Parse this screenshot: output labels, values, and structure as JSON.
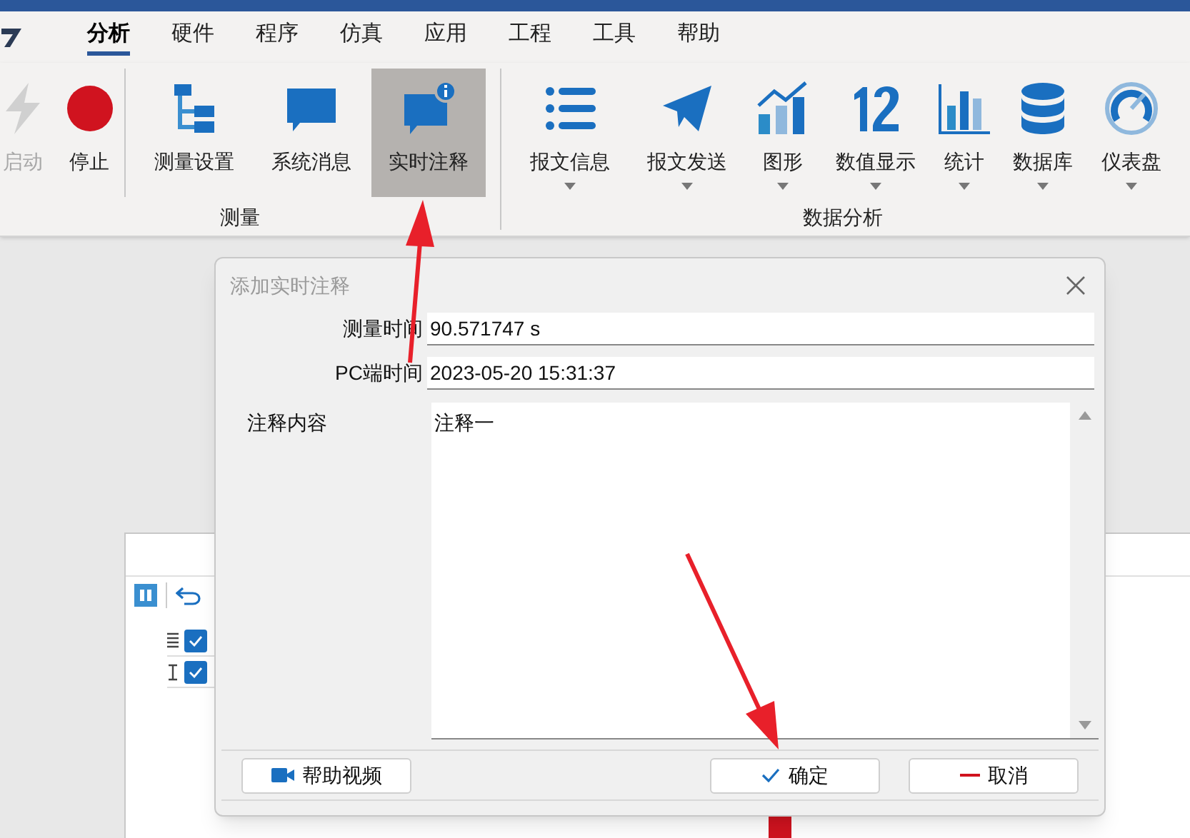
{
  "menu_tabs": [
    {
      "label": "分析",
      "selected": true
    },
    {
      "label": "硬件",
      "selected": false
    },
    {
      "label": "程序",
      "selected": false
    },
    {
      "label": "仿真",
      "selected": false
    },
    {
      "label": "应用",
      "selected": false
    },
    {
      "label": "工程",
      "selected": false
    },
    {
      "label": "工具",
      "selected": false
    },
    {
      "label": "帮助",
      "selected": false
    }
  ],
  "ribbon_groups": [
    {
      "label": "测量",
      "buttons": [
        {
          "label": "启动",
          "disabled": true,
          "selected": false,
          "has_menu": false
        },
        {
          "label": "停止",
          "disabled": false,
          "selected": false,
          "has_menu": false,
          "separator_after": true
        },
        {
          "label": "测量设置",
          "disabled": false,
          "selected": false,
          "has_menu": false
        },
        {
          "label": "系统消息",
          "disabled": false,
          "selected": false,
          "has_menu": false
        },
        {
          "label": "实时注释",
          "disabled": false,
          "selected": true,
          "has_menu": false
        }
      ]
    },
    {
      "label": "数据分析",
      "buttons": [
        {
          "label": "报文信息",
          "disabled": false,
          "selected": false,
          "has_menu": true
        },
        {
          "label": "报文发送",
          "disabled": false,
          "selected": false,
          "has_menu": true
        },
        {
          "label": "图形",
          "disabled": false,
          "selected": false,
          "has_menu": true
        },
        {
          "label": "数值显示",
          "disabled": false,
          "selected": false,
          "has_menu": true
        },
        {
          "label": "统计",
          "disabled": false,
          "selected": false,
          "has_menu": true
        },
        {
          "label": "数据库",
          "disabled": false,
          "selected": false,
          "has_menu": true
        },
        {
          "label": "仪表盘",
          "disabled": false,
          "selected": false,
          "has_menu": true
        }
      ]
    }
  ],
  "background_window": {
    "checkboxes": [
      {
        "checked": true
      },
      {
        "checked": true
      }
    ]
  },
  "dialog": {
    "title": "添加实时注释",
    "fields": [
      {
        "label": "测量时间",
        "value": "90.571747 s"
      },
      {
        "label": "PC端时间",
        "value": "2023-05-20 15:31:37"
      }
    ],
    "note": {
      "label": "注释内容",
      "value": "注释一"
    },
    "buttons": [
      {
        "label": "帮助视频",
        "kind": "help"
      },
      {
        "label": "确定",
        "kind": "ok"
      },
      {
        "label": "取消",
        "kind": "cancel"
      }
    ]
  }
}
